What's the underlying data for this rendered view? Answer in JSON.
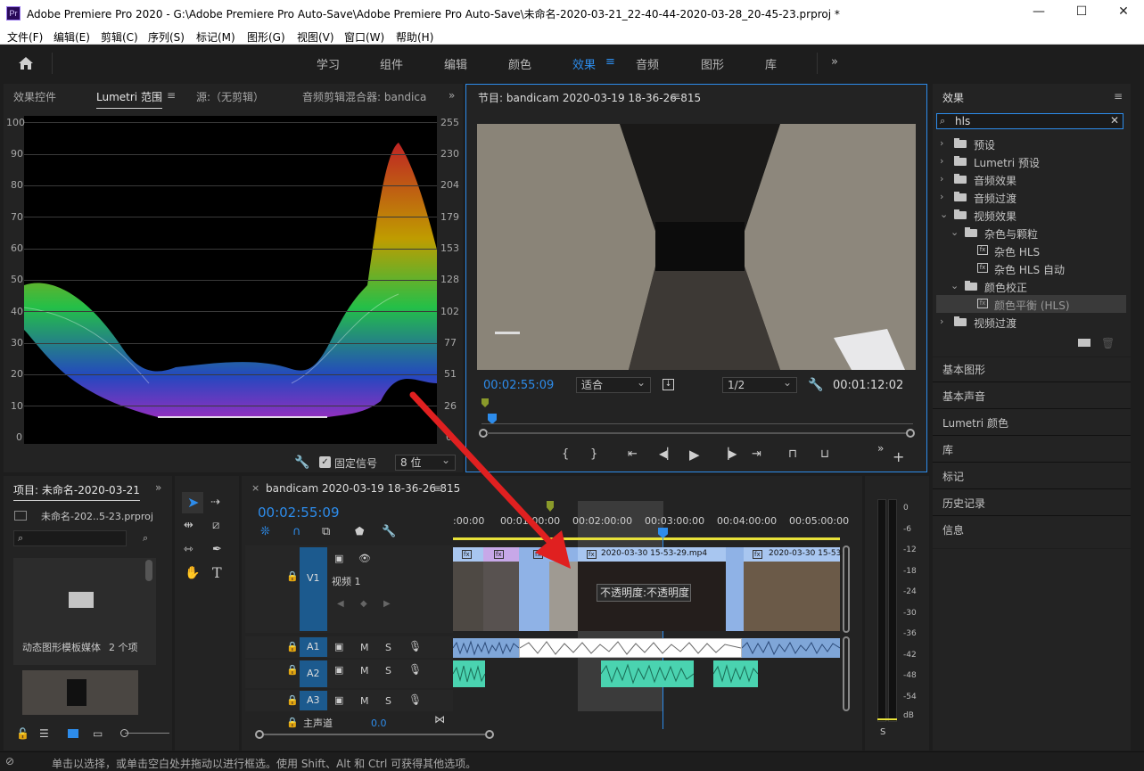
{
  "title": "Adobe Premiere Pro 2020 - G:\\Adobe Premiere Pro Auto-Save\\Adobe Premiere Pro Auto-Save\\未命名-2020-03-21_22-40-44-2020-03-28_20-45-23.prproj *",
  "app_icon": "Pr",
  "window_buttons": [
    "—",
    "☐",
    "✕"
  ],
  "menu": [
    "文件(F)",
    "编辑(E)",
    "剪辑(C)",
    "序列(S)",
    "标记(M)",
    "图形(G)",
    "视图(V)",
    "窗口(W)",
    "帮助(H)"
  ],
  "workspaces": [
    "学习",
    "组件",
    "编辑",
    "颜色",
    "效果",
    "音频",
    "图形",
    "库"
  ],
  "active_workspace": "效果",
  "source_panel": {
    "tabs": [
      "效果控件",
      "Lumetri 范围",
      "源:（无剪辑）",
      "音频剪辑混合器: bandica"
    ],
    "active_tab": "Lumetri 范围",
    "left_scale": [
      "100",
      "90",
      "80",
      "70",
      "60",
      "50",
      "40",
      "30",
      "20",
      "10",
      "0"
    ],
    "right_scale": [
      "255",
      "230",
      "204",
      "179",
      "153",
      "128",
      "102",
      "77",
      "51",
      "26",
      "0"
    ],
    "clamp_label": "固定信号",
    "bit_depth": "8 位"
  },
  "program": {
    "title": "节目: bandicam 2020-03-19 18-36-26-815",
    "timecode": "00:02:55:09",
    "fit": "适合",
    "resolution": "1/2",
    "duration": "00:01:12:02"
  },
  "effects": {
    "title": "效果",
    "search": "hls",
    "tree": [
      {
        "label": "预设",
        "level": 0,
        "type": "star-folder",
        "open": false
      },
      {
        "label": "Lumetri 预设",
        "level": 0,
        "type": "star-folder",
        "open": false
      },
      {
        "label": "音频效果",
        "level": 0,
        "type": "folder",
        "open": false
      },
      {
        "label": "音频过渡",
        "level": 0,
        "type": "folder",
        "open": false
      },
      {
        "label": "视频效果",
        "level": 0,
        "type": "folder",
        "open": true
      },
      {
        "label": "杂色与颗粒",
        "level": 1,
        "type": "folder",
        "open": true
      },
      {
        "label": "杂色 HLS",
        "level": 2,
        "type": "fx"
      },
      {
        "label": "杂色 HLS 自动",
        "level": 2,
        "type": "fx"
      },
      {
        "label": "颜色校正",
        "level": 1,
        "type": "folder",
        "open": true
      },
      {
        "label": "颜色平衡 (HLS)",
        "level": 2,
        "type": "fx",
        "selected": true
      },
      {
        "label": "视频过渡",
        "level": 0,
        "type": "folder",
        "open": false
      }
    ],
    "collapsed_panels": [
      "基本图形",
      "基本声音",
      "Lumetri 颜色",
      "库",
      "标记",
      "历史记录",
      "信息"
    ]
  },
  "project": {
    "tab": "项目: 未命名-2020-03-21",
    "file": "未命名-202..5-23.prproj",
    "bin_name": "动态图形模板媒体",
    "bin_count": "2 个项"
  },
  "timeline": {
    "tab": "bandicam 2020-03-19 18-36-26-815",
    "timecode": "00:02:55:09",
    "ruler": [
      ":00:00",
      "00:01:00:00",
      "00:02:00:00",
      "00:03:00:00",
      "00:04:00:00",
      "00:05:00:00"
    ],
    "tracks": [
      {
        "id": "V1",
        "name": "视频 1"
      },
      {
        "id": "A1"
      },
      {
        "id": "A2"
      },
      {
        "id": "A3"
      }
    ],
    "master": "主声道",
    "master_value": "0.0",
    "clips": [
      "2020-03-30 15-53-29.mp4",
      "2020-03-30 15-53-"
    ],
    "tooltip": "不透明度:不透明度",
    "track_toggles": [
      "M",
      "S"
    ]
  },
  "meter": {
    "scale": [
      "0",
      "-6",
      "-12",
      "-18",
      "-24",
      "-30",
      "-36",
      "-42",
      "-48",
      "-54"
    ],
    "unit": "dB",
    "solo": "S"
  },
  "status": "单击以选择，或单击空白处并拖动以进行框选。使用 Shift、Alt 和 Ctrl 可获得其他选项。",
  "colors": {
    "accent": "#2d8ceb",
    "v1_clip": "#a8c6f0",
    "a1_clip": "#7fa6d8",
    "a2_clip": "#4ad3b0",
    "playhead": "#2d8ceb",
    "arrow": "#e02020"
  }
}
